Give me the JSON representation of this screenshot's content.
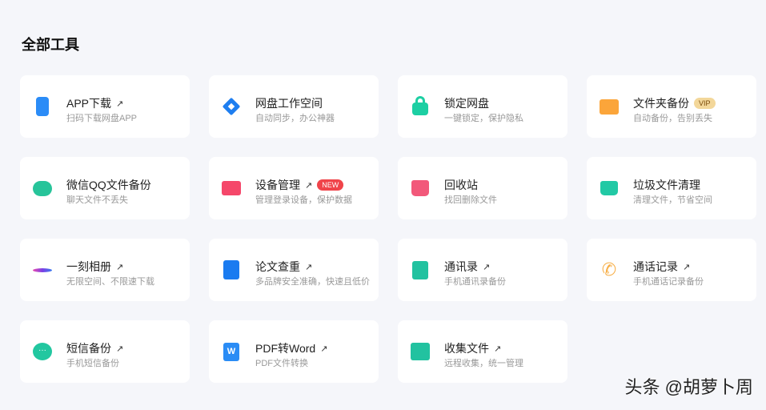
{
  "section_title": "全部工具",
  "tools": [
    {
      "name": "APP下载",
      "desc": "扫码下载网盘APP",
      "arrow": true,
      "icon": "phone-icon",
      "color": "#2b8cf7"
    },
    {
      "name": "网盘工作空间",
      "desc": "自动同步，办公神器",
      "arrow": false,
      "icon": "workspace-icon",
      "color": "#1e7ef0"
    },
    {
      "name": "锁定网盘",
      "desc": "一键锁定，保护隐私",
      "arrow": false,
      "icon": "lock-icon",
      "color": "#1ccfa3"
    },
    {
      "name": "文件夹备份",
      "desc": "自动备份，告别丢失",
      "arrow": false,
      "icon": "folder-icon",
      "color": "#fba53a",
      "badge": "VIP",
      "badge_bg": "#f3d79a",
      "badge_fg": "#7a4b0b"
    },
    {
      "name": "微信QQ文件备份",
      "desc": "聊天文件不丢失",
      "arrow": false,
      "icon": "chat-icon",
      "color": "#27c49a"
    },
    {
      "name": "设备管理",
      "desc": "管理登录设备，保护数据",
      "arrow": true,
      "icon": "devices-icon",
      "color": "#f5476a",
      "badge": "NEW",
      "badge_bg": "#f0444a",
      "badge_fg": "#ffffff"
    },
    {
      "name": "回收站",
      "desc": "找回删除文件",
      "arrow": false,
      "icon": "recycle-bin-icon",
      "color": "#f2587a"
    },
    {
      "name": "垃圾文件清理",
      "desc": "清理文件，节省空间",
      "arrow": false,
      "icon": "basket-icon",
      "color": "#22c9a5"
    },
    {
      "name": "一刻相册",
      "desc": "无限空间、不限速下载",
      "arrow": true,
      "icon": "album-icon",
      "color": "#7b3fe4"
    },
    {
      "name": "论文查重",
      "desc": "多品牌安全准确，快速且低价",
      "arrow": true,
      "icon": "paper-check-icon",
      "color": "#1a7bf0"
    },
    {
      "name": "通讯录",
      "desc": "手机通讯录备份",
      "arrow": true,
      "icon": "contacts-icon",
      "color": "#22c2a0"
    },
    {
      "name": "通话记录",
      "desc": "手机通话记录备份",
      "arrow": true,
      "icon": "phone-call-icon",
      "color": "#f7b04a"
    },
    {
      "name": "短信备份",
      "desc": "手机短信备份",
      "arrow": true,
      "icon": "sms-icon",
      "color": "#22c7a0"
    },
    {
      "name": "PDF转Word",
      "desc": "PDF文件转换",
      "arrow": true,
      "icon": "word-icon",
      "color": "#2a8cf5"
    },
    {
      "name": "收集文件",
      "desc": "远程收集，统一管理",
      "arrow": true,
      "icon": "collect-icon",
      "color": "#22c2a0"
    }
  ],
  "arrow_glyph": "↗",
  "watermark": "头条 @胡萝卜周"
}
